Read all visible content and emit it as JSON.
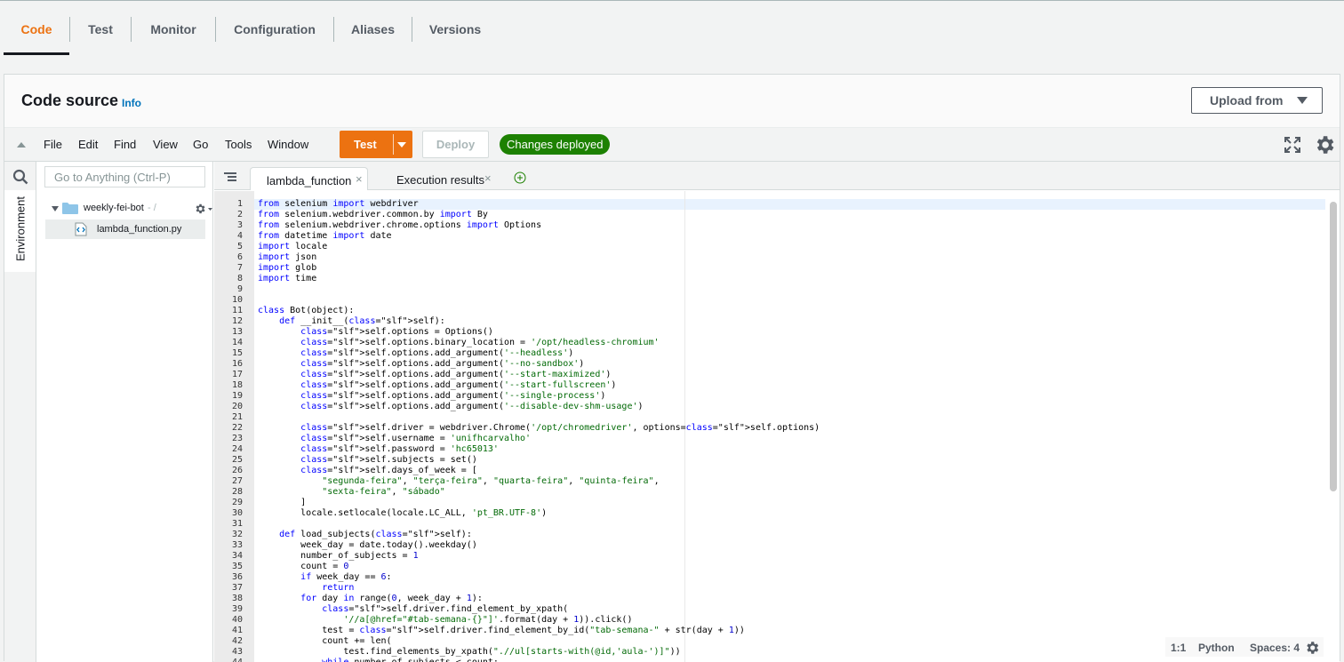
{
  "tabs": [
    {
      "label": "Code",
      "active": true
    },
    {
      "label": "Test"
    },
    {
      "label": "Monitor"
    },
    {
      "label": "Configuration"
    },
    {
      "label": "Aliases"
    },
    {
      "label": "Versions"
    }
  ],
  "colors": {
    "accent": "#ec7211",
    "success": "#1d8102",
    "link": "#0073bb"
  },
  "panel": {
    "title": "Code source",
    "info_label": "Info",
    "upload_label": "Upload from"
  },
  "menubar": {
    "items": [
      "File",
      "Edit",
      "Find",
      "View",
      "Go",
      "Tools",
      "Window"
    ],
    "test_label": "Test",
    "deploy_label": "Deploy",
    "status": "Changes deployed"
  },
  "sidebar": {
    "env_tab_label": "Environment",
    "search_placeholder": "Go to Anything (Ctrl-P)",
    "folder_name": "weekly-fei-bot",
    "folder_suffix": "- /",
    "file_name": "lambda_function.py"
  },
  "editor_tabs": [
    {
      "label": "lambda_function",
      "close": "×",
      "active": true
    },
    {
      "label": "Execution results",
      "close": "×"
    }
  ],
  "code_lines": [
    "from selenium import webdriver",
    "from selenium.webdriver.common.by import By",
    "from selenium.webdriver.chrome.options import Options",
    "from datetime import date",
    "import locale",
    "import json",
    "import glob",
    "import time",
    "",
    "",
    "class Bot(object):",
    "    def __init__(self):",
    "        self.options = Options()",
    "        self.options.binary_location = '/opt/headless-chromium'",
    "        self.options.add_argument('--headless')",
    "        self.options.add_argument('--no-sandbox')",
    "        self.options.add_argument('--start-maximized')",
    "        self.options.add_argument('--start-fullscreen')",
    "        self.options.add_argument('--single-process')",
    "        self.options.add_argument('--disable-dev-shm-usage')",
    "",
    "        self.driver = webdriver.Chrome('/opt/chromedriver', options=self.options)",
    "        self.username = 'unifhcarvalho'",
    "        self.password = 'hc65013'",
    "        self.subjects = set()",
    "        self.days_of_week = [",
    "            \"segunda-feira\", \"terça-feira\", \"quarta-feira\", \"quinta-feira\",",
    "            \"sexta-feira\", \"sábado\"",
    "        ]",
    "        locale.setlocale(locale.LC_ALL, 'pt_BR.UTF-8')",
    "",
    "    def load_subjects(self):",
    "        week_day = date.today().weekday()",
    "        number_of_subjects = 1",
    "        count = 0",
    "        if week_day == 6:",
    "            return",
    "        for day in range(0, week_day + 1):",
    "            self.driver.find_element_by_xpath(",
    "                '//a[@href=\"#tab-semana-{}\"]'.format(day + 1)).click()",
    "            test = self.driver.find_element_by_id(\"tab-semana-\" + str(day + 1))",
    "            count += len(",
    "                test.find_elements_by_xpath(\".//ul[starts-with(@id,'aula-')]\"))",
    "            while number_of_subjects < count:"
  ],
  "statusbar": {
    "position": "1:1",
    "language": "Python",
    "spaces": "Spaces: 4"
  }
}
